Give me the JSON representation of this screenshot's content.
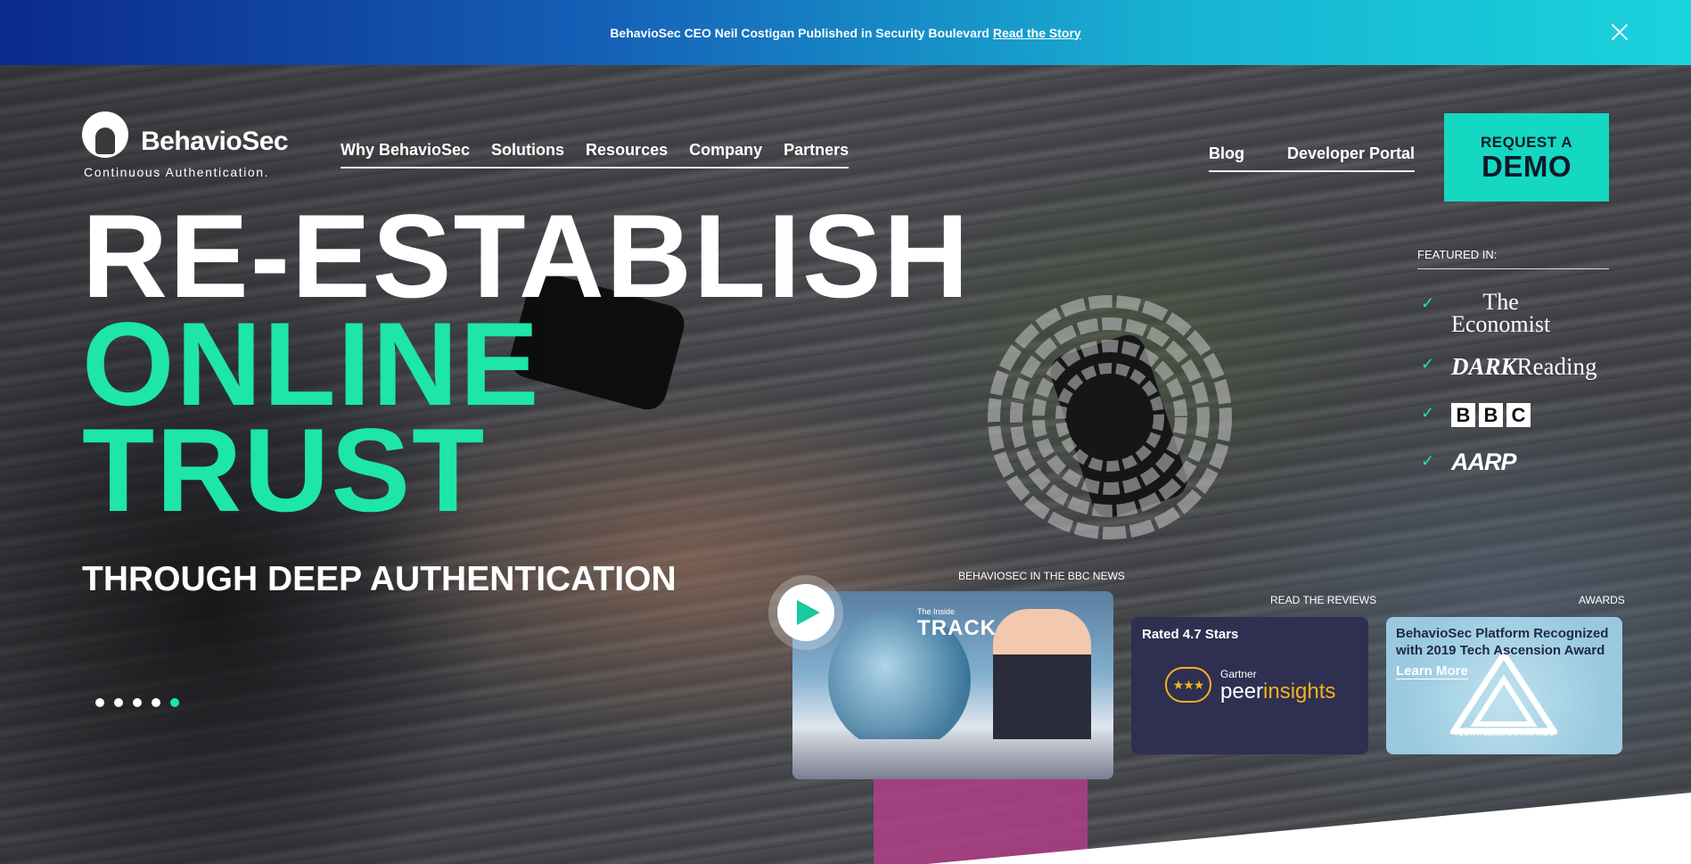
{
  "announcement": {
    "text": "BehavioSec CEO Neil Costigan Published in Security Boulevard",
    "link": "Read the Story"
  },
  "logo": {
    "name": "BehavioSec",
    "tagline": "Continuous Authentication."
  },
  "nav": {
    "items": [
      "Why BehavioSec",
      "Solutions",
      "Resources",
      "Company",
      "Partners"
    ],
    "secondary": [
      "Blog",
      "Developer Portal"
    ]
  },
  "cta": {
    "line1": "REQUEST A",
    "line2": "DEMO"
  },
  "hero": {
    "line1": "RE-ESTABLISH",
    "line2": "ONLINE",
    "line3": "TRUST",
    "subtitle": "THROUGH DEEP AUTHENTICATION",
    "slides": 5,
    "active_slide": 5
  },
  "featured": {
    "title": "FEATURED IN:",
    "outlets": [
      "The Economist",
      "DARK Reading",
      "BBC",
      "AARP"
    ]
  },
  "cards": {
    "video": {
      "label": "BEHAVIOSEC IN THE BBC NEWS",
      "show_small": "The Inside",
      "show": "TRACK"
    },
    "reviews": {
      "label": "READ THE REVIEWS",
      "title": "Rated 4.7 Stars",
      "brand_top": "Gartner",
      "brand_a": "peer",
      "brand_b": "insights"
    },
    "awards": {
      "label": "AWARDS",
      "title": "BehavioSec Platform Recognized with 2019 Tech Ascension Award",
      "link": "Learn More",
      "badge": "TECH ACENSION AWARDS"
    }
  },
  "colors": {
    "accent": "#1de6a8",
    "cta": "#14d8c2",
    "card_dark": "#2f2f52"
  }
}
